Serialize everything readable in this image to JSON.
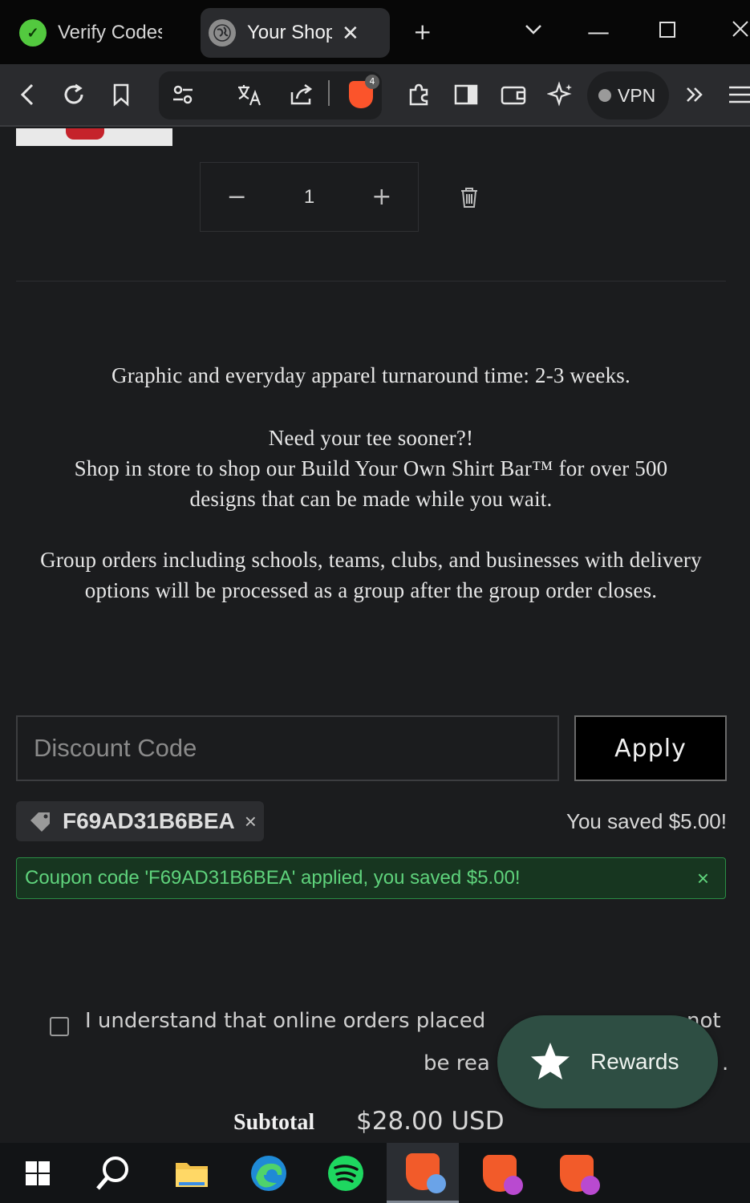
{
  "browser": {
    "tabs": [
      {
        "label": "Verify Codes –",
        "icon": "verify-codes-favicon"
      },
      {
        "label": "Your Shop",
        "icon": "globe-icon",
        "active": true
      }
    ],
    "new_tab": "+",
    "tab_menu": "⌄",
    "window_controls": {
      "minimize": "—",
      "maximize": "☐",
      "close": "✕"
    },
    "toolbar": {
      "vpn_label": "VPN",
      "shield_badge": "4",
      "more": "»"
    }
  },
  "cart": {
    "quantity": "1",
    "decrement": "−",
    "increment": "+"
  },
  "notice": {
    "turnaround": "Graphic and everyday apparel turnaround time: 2-3 weeks.",
    "sooner_title": "Need your tee sooner?!",
    "sooner_body": "Shop in store to shop our Build Your Own Shirt Bar™ for over 500 designs that can be made while you wait.",
    "group_orders": "Group orders including schools, teams, clubs, and businesses with delivery options will be processed as a group after the group order closes."
  },
  "discount": {
    "placeholder": "Discount Code",
    "apply_label": "Apply",
    "applied_code": "F69AD31B6BEA",
    "remove_symbol": "×",
    "saved_text": "You saved $5.00!",
    "success_message": "Coupon code 'F69AD31B6BEA' applied, you saved $5.00!",
    "success_close": "×"
  },
  "agreement": {
    "line1": "I understand that online orders placed",
    "line1_tail": "not",
    "line2": "be rea",
    "line2_tail": "."
  },
  "rewards": {
    "label": "Rewards"
  },
  "summary": {
    "subtotal_label": "Subtotal",
    "subtotal_value": "$28.00 USD"
  },
  "taskbar": {
    "apps": [
      "windows-start",
      "search",
      "file-explorer",
      "edge",
      "spotify",
      "brave",
      "brave",
      "brave"
    ]
  }
}
